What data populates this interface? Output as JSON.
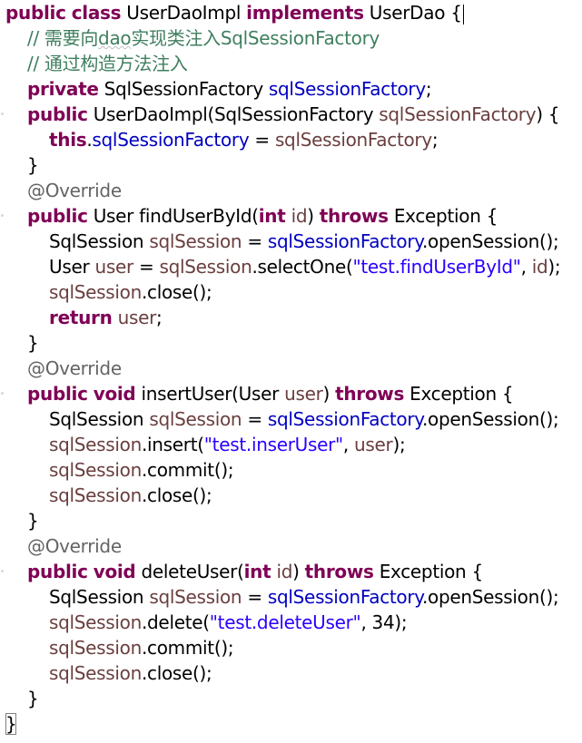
{
  "editor": {
    "lines": [
      {
        "indent": 0,
        "tokens": [
          {
            "k": "kw",
            "t": "public"
          },
          {
            "k": "pl",
            "t": " "
          },
          {
            "k": "kw",
            "t": "class"
          },
          {
            "k": "pl",
            "t": " UserDaoImpl "
          },
          {
            "k": "kw",
            "t": "implements"
          },
          {
            "k": "pl",
            "t": " UserDao {"
          }
        ]
      },
      {
        "indent": 1,
        "tokens": [
          {
            "k": "cm",
            "t": "// 需要向"
          },
          {
            "k": "cm",
            "t": "dao",
            "sq": true
          },
          {
            "k": "cm",
            "t": "实现类注入SqlSessionFactory"
          }
        ]
      },
      {
        "indent": 1,
        "tokens": [
          {
            "k": "cm",
            "t": "// 通过构造方法注入"
          }
        ]
      },
      {
        "indent": 1,
        "tokens": [
          {
            "k": "kw",
            "t": "private"
          },
          {
            "k": "pl",
            "t": " SqlSessionFactory "
          },
          {
            "k": "fd",
            "t": "sqlSessionFactory"
          },
          {
            "k": "pl",
            "t": ";"
          }
        ]
      },
      {
        "indent": 1,
        "tokens": [
          {
            "k": "kw",
            "t": "public"
          },
          {
            "k": "pl",
            "t": " UserDaoImpl(SqlSessionFactory "
          },
          {
            "k": "pm",
            "t": "sqlSessionFactory"
          },
          {
            "k": "pl",
            "t": ") {"
          }
        ]
      },
      {
        "indent": 2,
        "tokens": [
          {
            "k": "kw",
            "t": "this"
          },
          {
            "k": "pl",
            "t": "."
          },
          {
            "k": "fd",
            "t": "sqlSessionFactory"
          },
          {
            "k": "pl",
            "t": " = "
          },
          {
            "k": "pm",
            "t": "sqlSessionFactory"
          },
          {
            "k": "pl",
            "t": ";"
          }
        ]
      },
      {
        "indent": 1,
        "tokens": [
          {
            "k": "pl",
            "t": "}"
          }
        ]
      },
      {
        "indent": 1,
        "tokens": [
          {
            "k": "an",
            "t": "@Override"
          }
        ]
      },
      {
        "indent": 1,
        "tokens": [
          {
            "k": "kw",
            "t": "public"
          },
          {
            "k": "pl",
            "t": " User findUserById("
          },
          {
            "k": "kw",
            "t": "int"
          },
          {
            "k": "pl",
            "t": " "
          },
          {
            "k": "pm",
            "t": "id"
          },
          {
            "k": "pl",
            "t": ") "
          },
          {
            "k": "kw",
            "t": "throws"
          },
          {
            "k": "pl",
            "t": " Exception {"
          }
        ]
      },
      {
        "indent": 2,
        "tokens": [
          {
            "k": "pl",
            "t": "SqlSession "
          },
          {
            "k": "pm",
            "t": "sqlSession"
          },
          {
            "k": "pl",
            "t": " = "
          },
          {
            "k": "fd",
            "t": "sqlSessionFactory"
          },
          {
            "k": "pl",
            "t": ".openSession();"
          }
        ]
      },
      {
        "indent": 2,
        "tokens": [
          {
            "k": "pl",
            "t": "User "
          },
          {
            "k": "pm",
            "t": "user"
          },
          {
            "k": "pl",
            "t": " = "
          },
          {
            "k": "pm",
            "t": "sqlSession"
          },
          {
            "k": "pl",
            "t": ".selectOne("
          },
          {
            "k": "st",
            "t": "\"test.findUserById\""
          },
          {
            "k": "pl",
            "t": ", "
          },
          {
            "k": "pm",
            "t": "id"
          },
          {
            "k": "pl",
            "t": ");"
          }
        ]
      },
      {
        "indent": 2,
        "tokens": [
          {
            "k": "pm",
            "t": "sqlSession"
          },
          {
            "k": "pl",
            "t": ".close();"
          }
        ]
      },
      {
        "indent": 2,
        "tokens": [
          {
            "k": "kw",
            "t": "return"
          },
          {
            "k": "pl",
            "t": " "
          },
          {
            "k": "pm",
            "t": "user"
          },
          {
            "k": "pl",
            "t": ";"
          }
        ]
      },
      {
        "indent": 1,
        "tokens": [
          {
            "k": "pl",
            "t": "}"
          }
        ]
      },
      {
        "indent": 1,
        "tokens": [
          {
            "k": "an",
            "t": "@Override"
          }
        ]
      },
      {
        "indent": 1,
        "tokens": [
          {
            "k": "kw",
            "t": "public"
          },
          {
            "k": "pl",
            "t": " "
          },
          {
            "k": "kw",
            "t": "void"
          },
          {
            "k": "pl",
            "t": " insertUser(User "
          },
          {
            "k": "pm",
            "t": "user"
          },
          {
            "k": "pl",
            "t": ") "
          },
          {
            "k": "kw",
            "t": "throws"
          },
          {
            "k": "pl",
            "t": " Exception {"
          }
        ]
      },
      {
        "indent": 2,
        "tokens": [
          {
            "k": "pl",
            "t": "SqlSession "
          },
          {
            "k": "pm",
            "t": "sqlSession"
          },
          {
            "k": "pl",
            "t": " = "
          },
          {
            "k": "fd",
            "t": "sqlSessionFactory"
          },
          {
            "k": "pl",
            "t": ".openSession();"
          }
        ]
      },
      {
        "indent": 2,
        "tokens": [
          {
            "k": "pm",
            "t": "sqlSession"
          },
          {
            "k": "pl",
            "t": ".insert("
          },
          {
            "k": "st",
            "t": "\"test.inserUser\""
          },
          {
            "k": "pl",
            "t": ", "
          },
          {
            "k": "pm",
            "t": "user"
          },
          {
            "k": "pl",
            "t": ");"
          }
        ]
      },
      {
        "indent": 2,
        "tokens": [
          {
            "k": "pm",
            "t": "sqlSession"
          },
          {
            "k": "pl",
            "t": ".commit();"
          }
        ]
      },
      {
        "indent": 2,
        "tokens": [
          {
            "k": "pm",
            "t": "sqlSession"
          },
          {
            "k": "pl",
            "t": ".close();"
          }
        ]
      },
      {
        "indent": 1,
        "tokens": [
          {
            "k": "pl",
            "t": "}"
          }
        ]
      },
      {
        "indent": 1,
        "tokens": [
          {
            "k": "an",
            "t": "@Override"
          }
        ]
      },
      {
        "indent": 1,
        "tokens": [
          {
            "k": "kw",
            "t": "public"
          },
          {
            "k": "pl",
            "t": " "
          },
          {
            "k": "kw",
            "t": "void"
          },
          {
            "k": "pl",
            "t": " deleteUser("
          },
          {
            "k": "kw",
            "t": "int"
          },
          {
            "k": "pl",
            "t": " "
          },
          {
            "k": "pm",
            "t": "id"
          },
          {
            "k": "pl",
            "t": ") "
          },
          {
            "k": "kw",
            "t": "throws"
          },
          {
            "k": "pl",
            "t": " Exception {"
          }
        ]
      },
      {
        "indent": 2,
        "tokens": [
          {
            "k": "pl",
            "t": "SqlSession "
          },
          {
            "k": "pm",
            "t": "sqlSession"
          },
          {
            "k": "pl",
            "t": " = "
          },
          {
            "k": "fd",
            "t": "sqlSessionFactory"
          },
          {
            "k": "pl",
            "t": ".openSession();"
          }
        ]
      },
      {
        "indent": 2,
        "tokens": [
          {
            "k": "pm",
            "t": "sqlSession"
          },
          {
            "k": "pl",
            "t": ".delete("
          },
          {
            "k": "st",
            "t": "\"test.deleteUser\""
          },
          {
            "k": "pl",
            "t": ", 34);"
          }
        ]
      },
      {
        "indent": 2,
        "tokens": [
          {
            "k": "pm",
            "t": "sqlSession"
          },
          {
            "k": "pl",
            "t": ".commit();"
          }
        ]
      },
      {
        "indent": 2,
        "tokens": [
          {
            "k": "pm",
            "t": "sqlSession"
          },
          {
            "k": "pl",
            "t": ".close();"
          }
        ]
      },
      {
        "indent": 1,
        "tokens": [
          {
            "k": "pl",
            "t": "}"
          }
        ]
      },
      {
        "indent": 0,
        "tokens": [
          {
            "k": "pl",
            "t": "}",
            "box": true
          }
        ]
      }
    ]
  },
  "colors": {
    "keyword": "#7f0055",
    "comment": "#3f7f5f",
    "annotation": "#646464",
    "field": "#0000c0",
    "parameter": "#6a3e3e",
    "string": "#2a00ff",
    "plain": "#000000"
  }
}
